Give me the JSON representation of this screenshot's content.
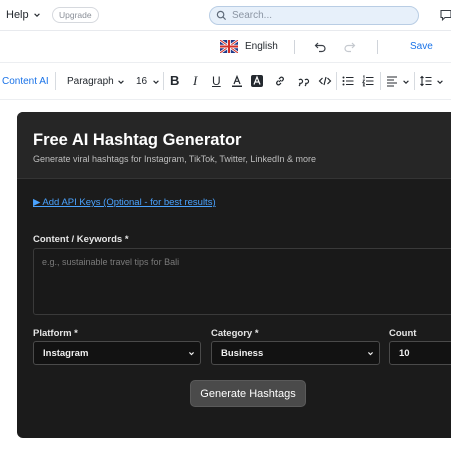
{
  "topbar": {
    "help_label": "Help",
    "upgrade_label": "Upgrade",
    "search_placeholder": "Search..."
  },
  "langbar": {
    "language": "English",
    "save_label": "Save"
  },
  "toolbar": {
    "content_ai_label": "Content AI",
    "paragraph_label": "Paragraph",
    "font_size": "16"
  },
  "card": {
    "title": "Free AI Hashtag Generator",
    "subtitle": "Generate viral hashtags for Instagram, TikTok, Twitter, LinkedIn & more",
    "api_link": "▶ Add API Keys (Optional - for best results)",
    "content_label": "Content / Keywords *",
    "content_placeholder": "e.g., sustainable travel tips for Bali",
    "platform_label": "Platform *",
    "platform_value": "Instagram",
    "category_label": "Category *",
    "category_value": "Business",
    "count_label": "Count",
    "count_value": "10",
    "generate_label": "Generate Hashtags"
  },
  "colors": {
    "accent": "#1a73e8",
    "card_bg": "#1b1b1b",
    "link": "#4aa3ff"
  }
}
